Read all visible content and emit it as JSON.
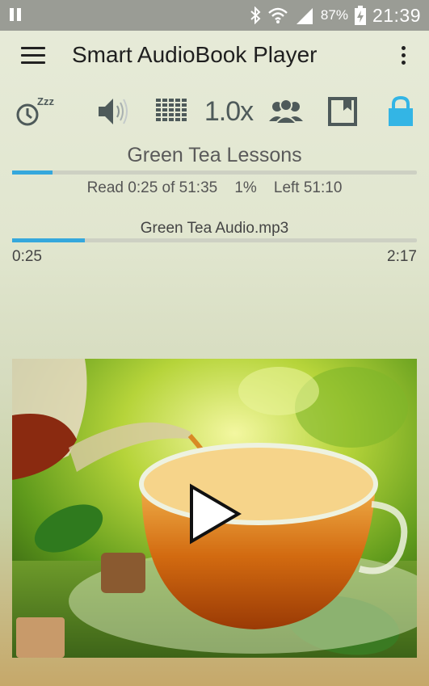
{
  "status_bar": {
    "battery_percent": "87%",
    "time": "21:39",
    "icons": [
      "pause-icon",
      "bluetooth-icon",
      "wifi-icon",
      "signal-icon",
      "battery-charging-icon"
    ]
  },
  "app_bar": {
    "title": "Smart AudioBook Player",
    "menu_icon": "hamburger-menu-icon",
    "overflow_icon": "more-vertical-icon"
  },
  "toolbar": {
    "sleep_timer_icon": "sleep-timer-icon",
    "volume_icon": "volume-icon",
    "equalizer_icon": "equalizer-icon",
    "speed_label": "1.0x",
    "characters_icon": "characters-icon",
    "bookmark_icon": "bookmark-icon",
    "lock_icon": "lock-icon",
    "lock_color": "#33b5e5"
  },
  "book": {
    "title": "Green Tea Lessons",
    "progress": 0.01,
    "stats": "Read 0:25 of 51:35    1%    Left 51:10"
  },
  "file": {
    "name": "Green Tea Audio.mp3",
    "current_time": "0:25",
    "duration": "2:17",
    "progress": 0.18
  },
  "cover": {
    "play_icon": "play-icon"
  },
  "colors": {
    "accent": "#35a8dc",
    "icon": "#4e5a5a"
  }
}
